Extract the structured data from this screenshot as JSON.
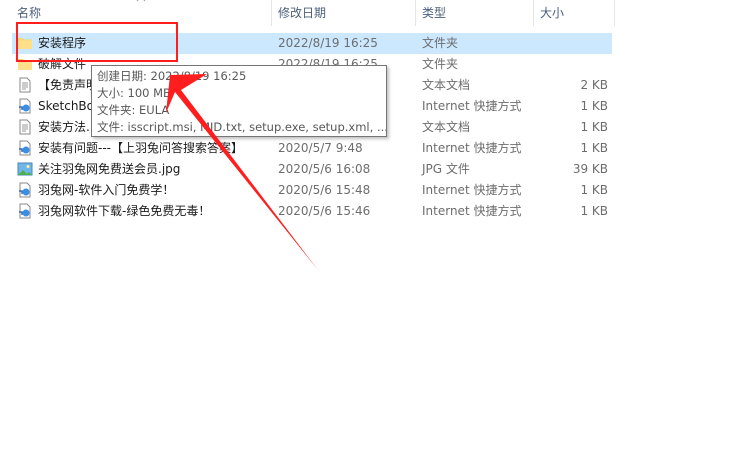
{
  "columns": {
    "name": "名称",
    "date": "修改日期",
    "type": "类型",
    "size": "大小"
  },
  "rows": [
    {
      "name": "安装程序",
      "date": "2022/8/19 16:25",
      "type": "文件夹",
      "size": "",
      "icon": "folder-icon"
    },
    {
      "name": "破解文件",
      "date": "2022/8/19 16:25",
      "type": "文件夹",
      "size": "",
      "icon": "folder-icon"
    },
    {
      "name": "【免责声明",
      "date": "",
      "type": "文本文档",
      "size": "2 KB",
      "icon": "text-document-icon"
    },
    {
      "name": "SketchBo",
      "date": "",
      "type": "Internet 快捷方式",
      "size": "1 KB",
      "icon": "internet-shortcut-icon"
    },
    {
      "name": "安装方法.",
      "date": "",
      "type": "文本文档",
      "size": "1 KB",
      "icon": "text-document-icon"
    },
    {
      "name": "安装有问题---【上羽兔问答搜索答案】",
      "date": "2020/5/7 9:48",
      "type": "Internet 快捷方式",
      "size": "1 KB",
      "icon": "internet-shortcut-icon"
    },
    {
      "name": "关注羽兔网免费送会员.jpg",
      "date": "2020/5/6 16:08",
      "type": "JPG 文件",
      "size": "39 KB",
      "icon": "image-file-icon"
    },
    {
      "name": "羽兔网-软件入门免费学！",
      "date": "2020/5/6 15:48",
      "type": "Internet 快捷方式",
      "size": "1 KB",
      "icon": "internet-shortcut-icon"
    },
    {
      "name": "羽兔网软件下载-绿色免费无毒！",
      "date": "2020/5/6 15:46",
      "type": "Internet 快捷方式",
      "size": "1 KB",
      "icon": "internet-shortcut-icon"
    }
  ],
  "tooltip": {
    "created": "创建日期: 2022/8/19 16:25",
    "size": "大小: 100 MB",
    "folders": "文件夹: EULA",
    "files": "文件: isscript.msi, MID.txt, setup.exe, setup.xml, ..."
  },
  "colors": {
    "selection": "#cce8ff",
    "annotation": "#ff1d1d",
    "header_text": "#4c607a"
  }
}
